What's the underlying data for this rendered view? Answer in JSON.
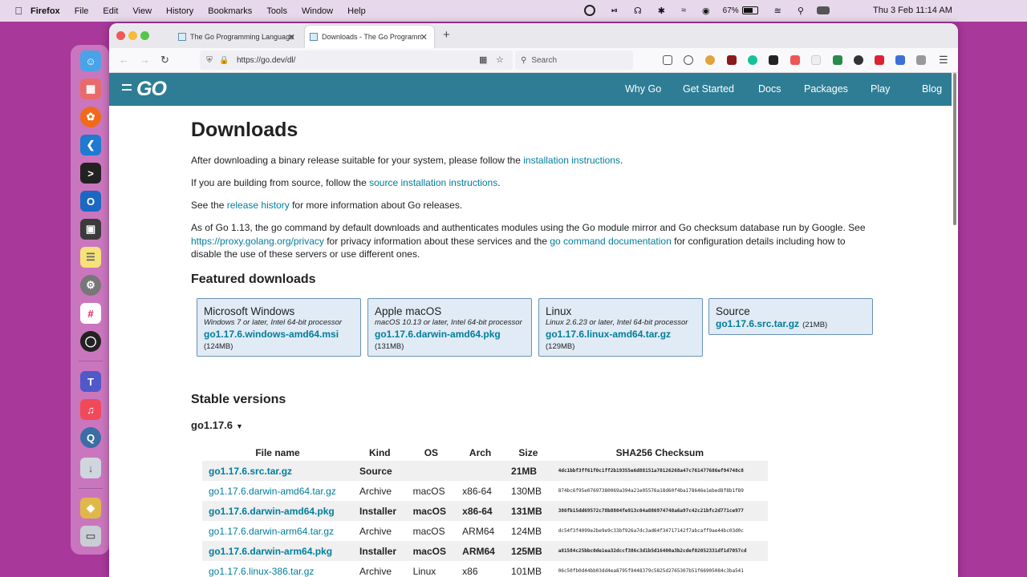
{
  "menubar": {
    "app": "Firefox",
    "items": [
      "File",
      "Edit",
      "View",
      "History",
      "Bookmarks",
      "Tools",
      "Window",
      "Help"
    ],
    "battery_percent": "67%",
    "battery_level": 0.67,
    "datetime": "Thu 3 Feb  11:14 AM"
  },
  "browser": {
    "tabs": [
      {
        "title": "The Go Programming Language"
      },
      {
        "title": "Downloads - The Go Programmi"
      }
    ],
    "url": "https://go.dev/dl/",
    "search_placeholder": "Search"
  },
  "site": {
    "logo": "GO",
    "nav": [
      "Why Go",
      "Get Started",
      "Docs",
      "Packages",
      "Play",
      "Blog"
    ]
  },
  "content": {
    "title": "Downloads",
    "p1": {
      "before": "After downloading a binary release suitable for your system, please follow the ",
      "link": "installation instructions",
      "after": "."
    },
    "p2": {
      "before": "If you are building from source, follow the ",
      "link": "source installation instructions",
      "after": "."
    },
    "p3": {
      "before": "See the ",
      "link": "release history",
      "after": " for more information about Go releases."
    },
    "p4": {
      "t1": "As of Go 1.13, the go command by default downloads and authenticates modules using the Go module mirror and Go checksum database run by Google. See ",
      "l1": "https://proxy.golang.org/privacy",
      "t2": " for privacy information about these services and the ",
      "l2": "go command documentation",
      "t3": " for configuration details including how to disable the use of these servers or use different ones."
    },
    "featured_heading": "Featured downloads",
    "featured": [
      {
        "os": "Microsoft Windows",
        "desc": "Windows 7 or later, Intel 64-bit processor",
        "file": "go1.17.6.windows-amd64.msi",
        "size": "(124MB)"
      },
      {
        "os": "Apple macOS",
        "desc": "macOS 10.13 or later, Intel 64-bit processor",
        "file": "go1.17.6.darwin-amd64.pkg",
        "size": "(131MB)"
      },
      {
        "os": "Linux",
        "desc": "Linux 2.6.23 or later, Intel 64-bit processor",
        "file": "go1.17.6.linux-amd64.tar.gz",
        "size": "(129MB)"
      },
      {
        "os": "Source",
        "desc": "",
        "file": "go1.17.6.src.tar.gz",
        "size": "(21MB)"
      }
    ],
    "stable_heading": "Stable versions",
    "version": "go1.17.6",
    "table": {
      "headers": [
        "File name",
        "Kind",
        "OS",
        "Arch",
        "Size",
        "SHA256 Checksum"
      ],
      "rows": [
        {
          "file": "go1.17.6.src.tar.gz",
          "kind": "Source",
          "os": "",
          "arch": "",
          "size": "21MB",
          "sha": "4dc1bbf3ff61f0c1ff2b19355e6d88151a70126268a47c761477686ef94748c8",
          "hl": true
        },
        {
          "file": "go1.17.6.darwin-amd64.tar.gz",
          "kind": "Archive",
          "os": "macOS",
          "arch": "x86-64",
          "size": "130MB",
          "sha": "874bc6f95e07697380069a394a21e05576a18d60f4ba178646e1ebed8f8b1f89",
          "hl": false
        },
        {
          "file": "go1.17.6.darwin-amd64.pkg",
          "kind": "Installer",
          "os": "macOS",
          "arch": "x86-64",
          "size": "131MB",
          "sha": "386fb15dd69572c78b8804fe913c04a886974748a6a97c42c21bfc2d771ce977",
          "hl": true
        },
        {
          "file": "go1.17.6.darwin-arm64.tar.gz",
          "kind": "Archive",
          "os": "macOS",
          "arch": "ARM64",
          "size": "124MB",
          "sha": "dc54f3f4099e2be9e9c33bf926a7dc3ad64f34717142f7abcaff9ae44bc03d0c",
          "hl": false
        },
        {
          "file": "go1.17.6.darwin-arm64.pkg",
          "kind": "Installer",
          "os": "macOS",
          "arch": "ARM64",
          "size": "125MB",
          "sha": "a81584c25bbc0de1ea32dccf386c3d1b5d16400a3b2cdef02052331df1d7057cd",
          "hl": true
        },
        {
          "file": "go1.17.6.linux-386.tar.gz",
          "kind": "Archive",
          "os": "Linux",
          "arch": "x86",
          "size": "101MB",
          "sha": "06c50fb0d44bb03dd4ea8795f9448379c5825d2765307b51f66905084c3ba541",
          "hl": false
        }
      ]
    }
  }
}
